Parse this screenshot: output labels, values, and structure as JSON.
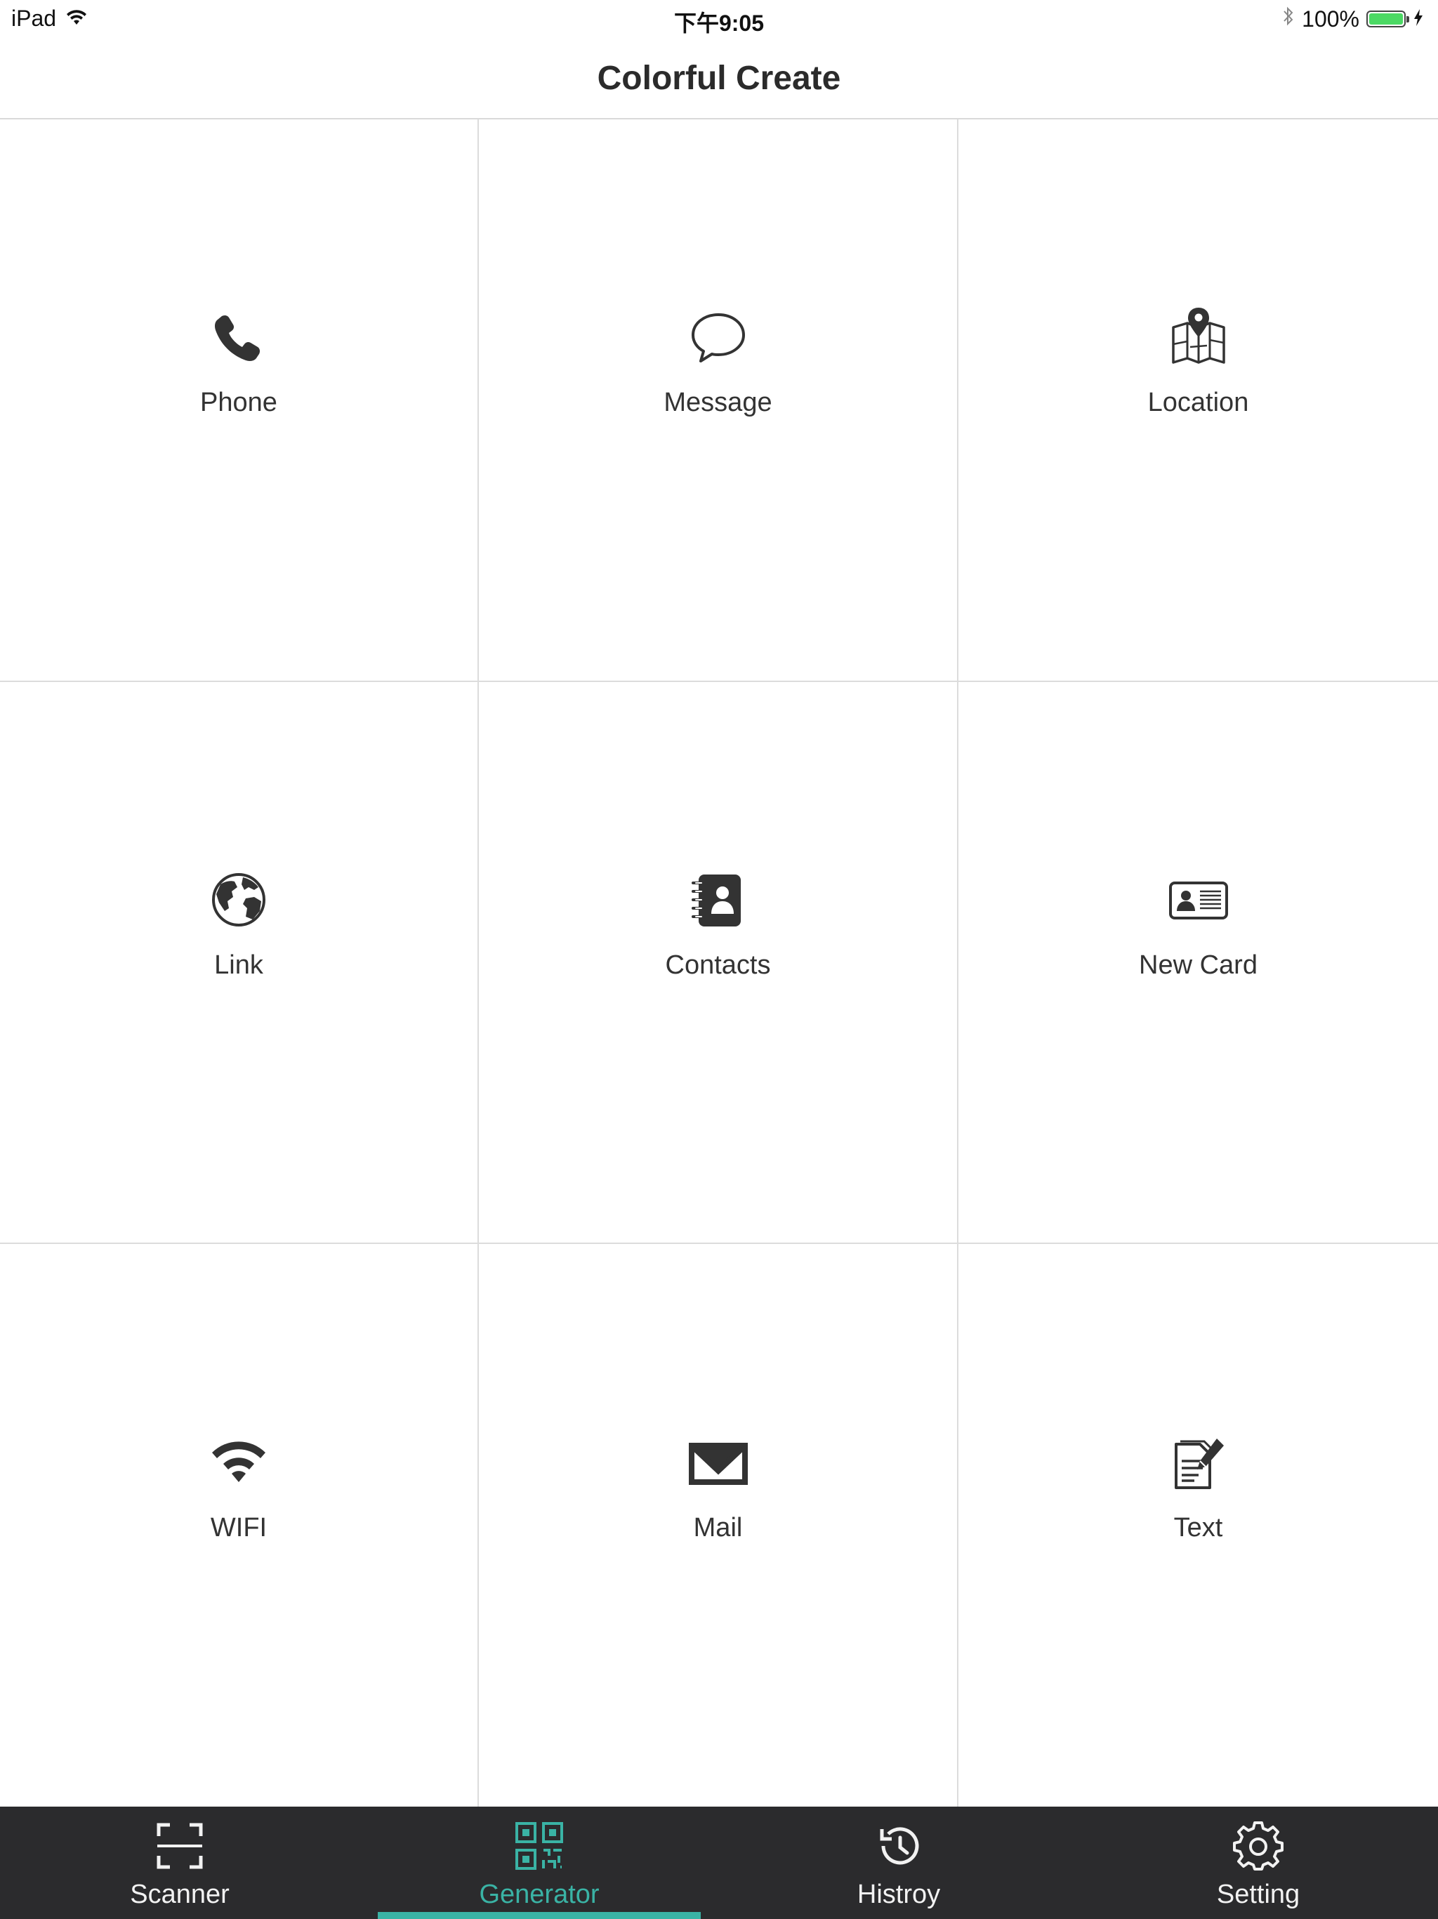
{
  "status_bar": {
    "device": "iPad",
    "time": "下午9:05",
    "battery_percent": "100%",
    "battery_level": 1.0
  },
  "nav": {
    "title": "Colorful Create"
  },
  "grid": {
    "items": [
      {
        "label": "Phone",
        "icon": "phone-icon"
      },
      {
        "label": "Message",
        "icon": "message-icon"
      },
      {
        "label": "Location",
        "icon": "map-pin-icon"
      },
      {
        "label": "Link",
        "icon": "globe-icon"
      },
      {
        "label": "Contacts",
        "icon": "contacts-book-icon"
      },
      {
        "label": "New Card",
        "icon": "id-card-icon"
      },
      {
        "label": "WIFI",
        "icon": "wifi-icon"
      },
      {
        "label": "Mail",
        "icon": "mail-icon"
      },
      {
        "label": "Text",
        "icon": "text-edit-icon"
      }
    ]
  },
  "tab_bar": {
    "tabs": [
      {
        "label": "Scanner",
        "icon": "scanner-icon",
        "active": false
      },
      {
        "label": "Generator",
        "icon": "qr-code-icon",
        "active": true
      },
      {
        "label": "Histroy",
        "icon": "history-icon",
        "active": false
      },
      {
        "label": "Setting",
        "icon": "gear-icon",
        "active": false
      }
    ]
  },
  "colors": {
    "accent": "#3ab3a5",
    "tab_bar_bg": "#2b2b2d",
    "battery": "#4cd964",
    "icon": "#333333",
    "divider": "#dcdcdc"
  }
}
